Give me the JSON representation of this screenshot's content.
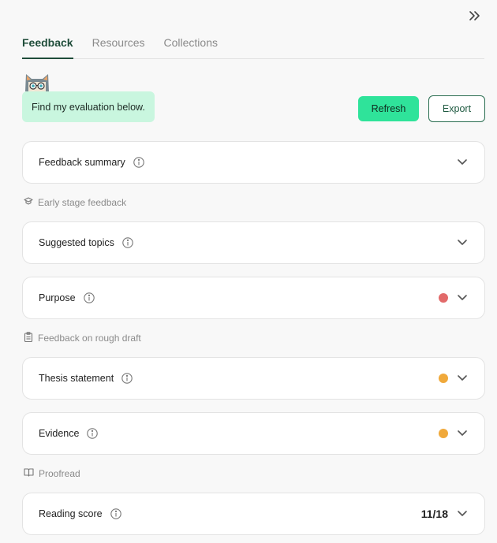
{
  "header": {
    "collapse_icon": "double-chevron-right-icon"
  },
  "tabs": [
    {
      "label": "Feedback",
      "active": true
    },
    {
      "label": "Resources",
      "active": false
    },
    {
      "label": "Collections",
      "active": false
    }
  ],
  "assistant": {
    "mascot_icon": "cat-mascot-icon",
    "message": "Find my evaluation below."
  },
  "actions": {
    "refresh_label": "Refresh",
    "export_label": "Export"
  },
  "sections": {
    "early_stage": {
      "label": "Early stage feedback",
      "icon": "graduation-cap-icon"
    },
    "rough_draft": {
      "label": "Feedback on rough draft",
      "icon": "clipboard-icon"
    },
    "proofread": {
      "label": "Proofread",
      "icon": "book-icon"
    }
  },
  "cards": {
    "feedback_summary": {
      "title": "Feedback summary"
    },
    "suggested_topics": {
      "title": "Suggested topics"
    },
    "purpose": {
      "title": "Purpose",
      "status_color": "#e26a6a"
    },
    "thesis_statement": {
      "title": "Thesis statement",
      "status_color": "#f0a93b"
    },
    "evidence": {
      "title": "Evidence",
      "status_color": "#f0a93b"
    },
    "reading_score": {
      "title": "Reading score",
      "score": "11/18"
    }
  }
}
